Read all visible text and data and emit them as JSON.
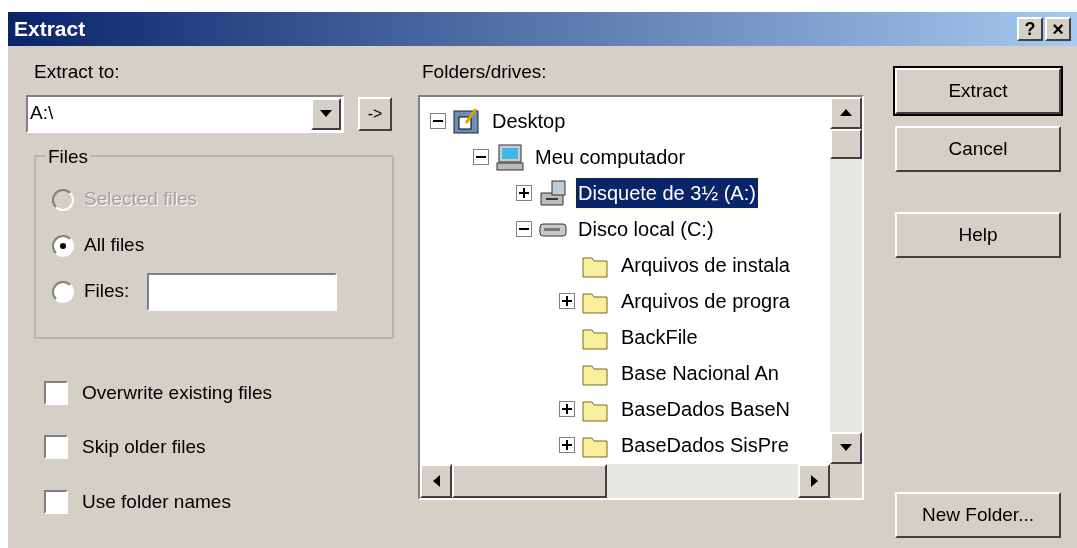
{
  "window": {
    "title": "Extract",
    "help_button": "?",
    "close_button": "×"
  },
  "extract_to": {
    "label": "Extract to:",
    "value": "A:\\",
    "go_button": "->"
  },
  "files_group": {
    "title": "Files",
    "options": [
      {
        "label": "Selected files",
        "selected": false,
        "disabled": true
      },
      {
        "label": "All files",
        "selected": true,
        "disabled": false
      },
      {
        "label": "Files:",
        "selected": false,
        "disabled": false,
        "kind": "with-field"
      }
    ]
  },
  "checkboxes": [
    {
      "label": "Overwrite existing files",
      "checked": false
    },
    {
      "label": "Skip older files",
      "checked": false
    },
    {
      "label": "Use folder names",
      "checked": false
    }
  ],
  "folders": {
    "label": "Folders/drives:",
    "tree": [
      {
        "label": "Desktop",
        "kind": "desktop",
        "expanded": true,
        "selected": false,
        "children": [
          {
            "label": "Meu computador",
            "kind": "computer",
            "expanded": true,
            "selected": false,
            "children": [
              {
                "label": "Disquete de 3½ (A:)",
                "kind": "floppy",
                "expanded": false,
                "selected": true
              },
              {
                "label": "Disco local (C:)",
                "kind": "drive",
                "expanded": true,
                "selected": false,
                "children": [
                  {
                    "label": "Arquivos de instala",
                    "kind": "folder",
                    "selected": false
                  },
                  {
                    "label": "Arquivos de progra",
                    "kind": "folder",
                    "expanded": false,
                    "selected": false
                  },
                  {
                    "label": "BackFile",
                    "kind": "folder",
                    "selected": false
                  },
                  {
                    "label": "Base Nacional An",
                    "kind": "folder",
                    "selected": false
                  },
                  {
                    "label": "BaseDados BaseN",
                    "kind": "folder",
                    "expanded": false,
                    "selected": false
                  },
                  {
                    "label": "BaseDados SisPre",
                    "kind": "folder",
                    "expanded": false,
                    "selected": false
                  }
                ]
              }
            ]
          }
        ]
      }
    ]
  },
  "buttons": [
    {
      "label": "Extract",
      "default": true,
      "kind": "top"
    },
    {
      "label": "Cancel",
      "default": false,
      "kind": "top"
    },
    {
      "label": "Help",
      "default": false,
      "kind": "help"
    },
    {
      "label": "New Folder...",
      "default": false,
      "kind": "bottom"
    }
  ]
}
